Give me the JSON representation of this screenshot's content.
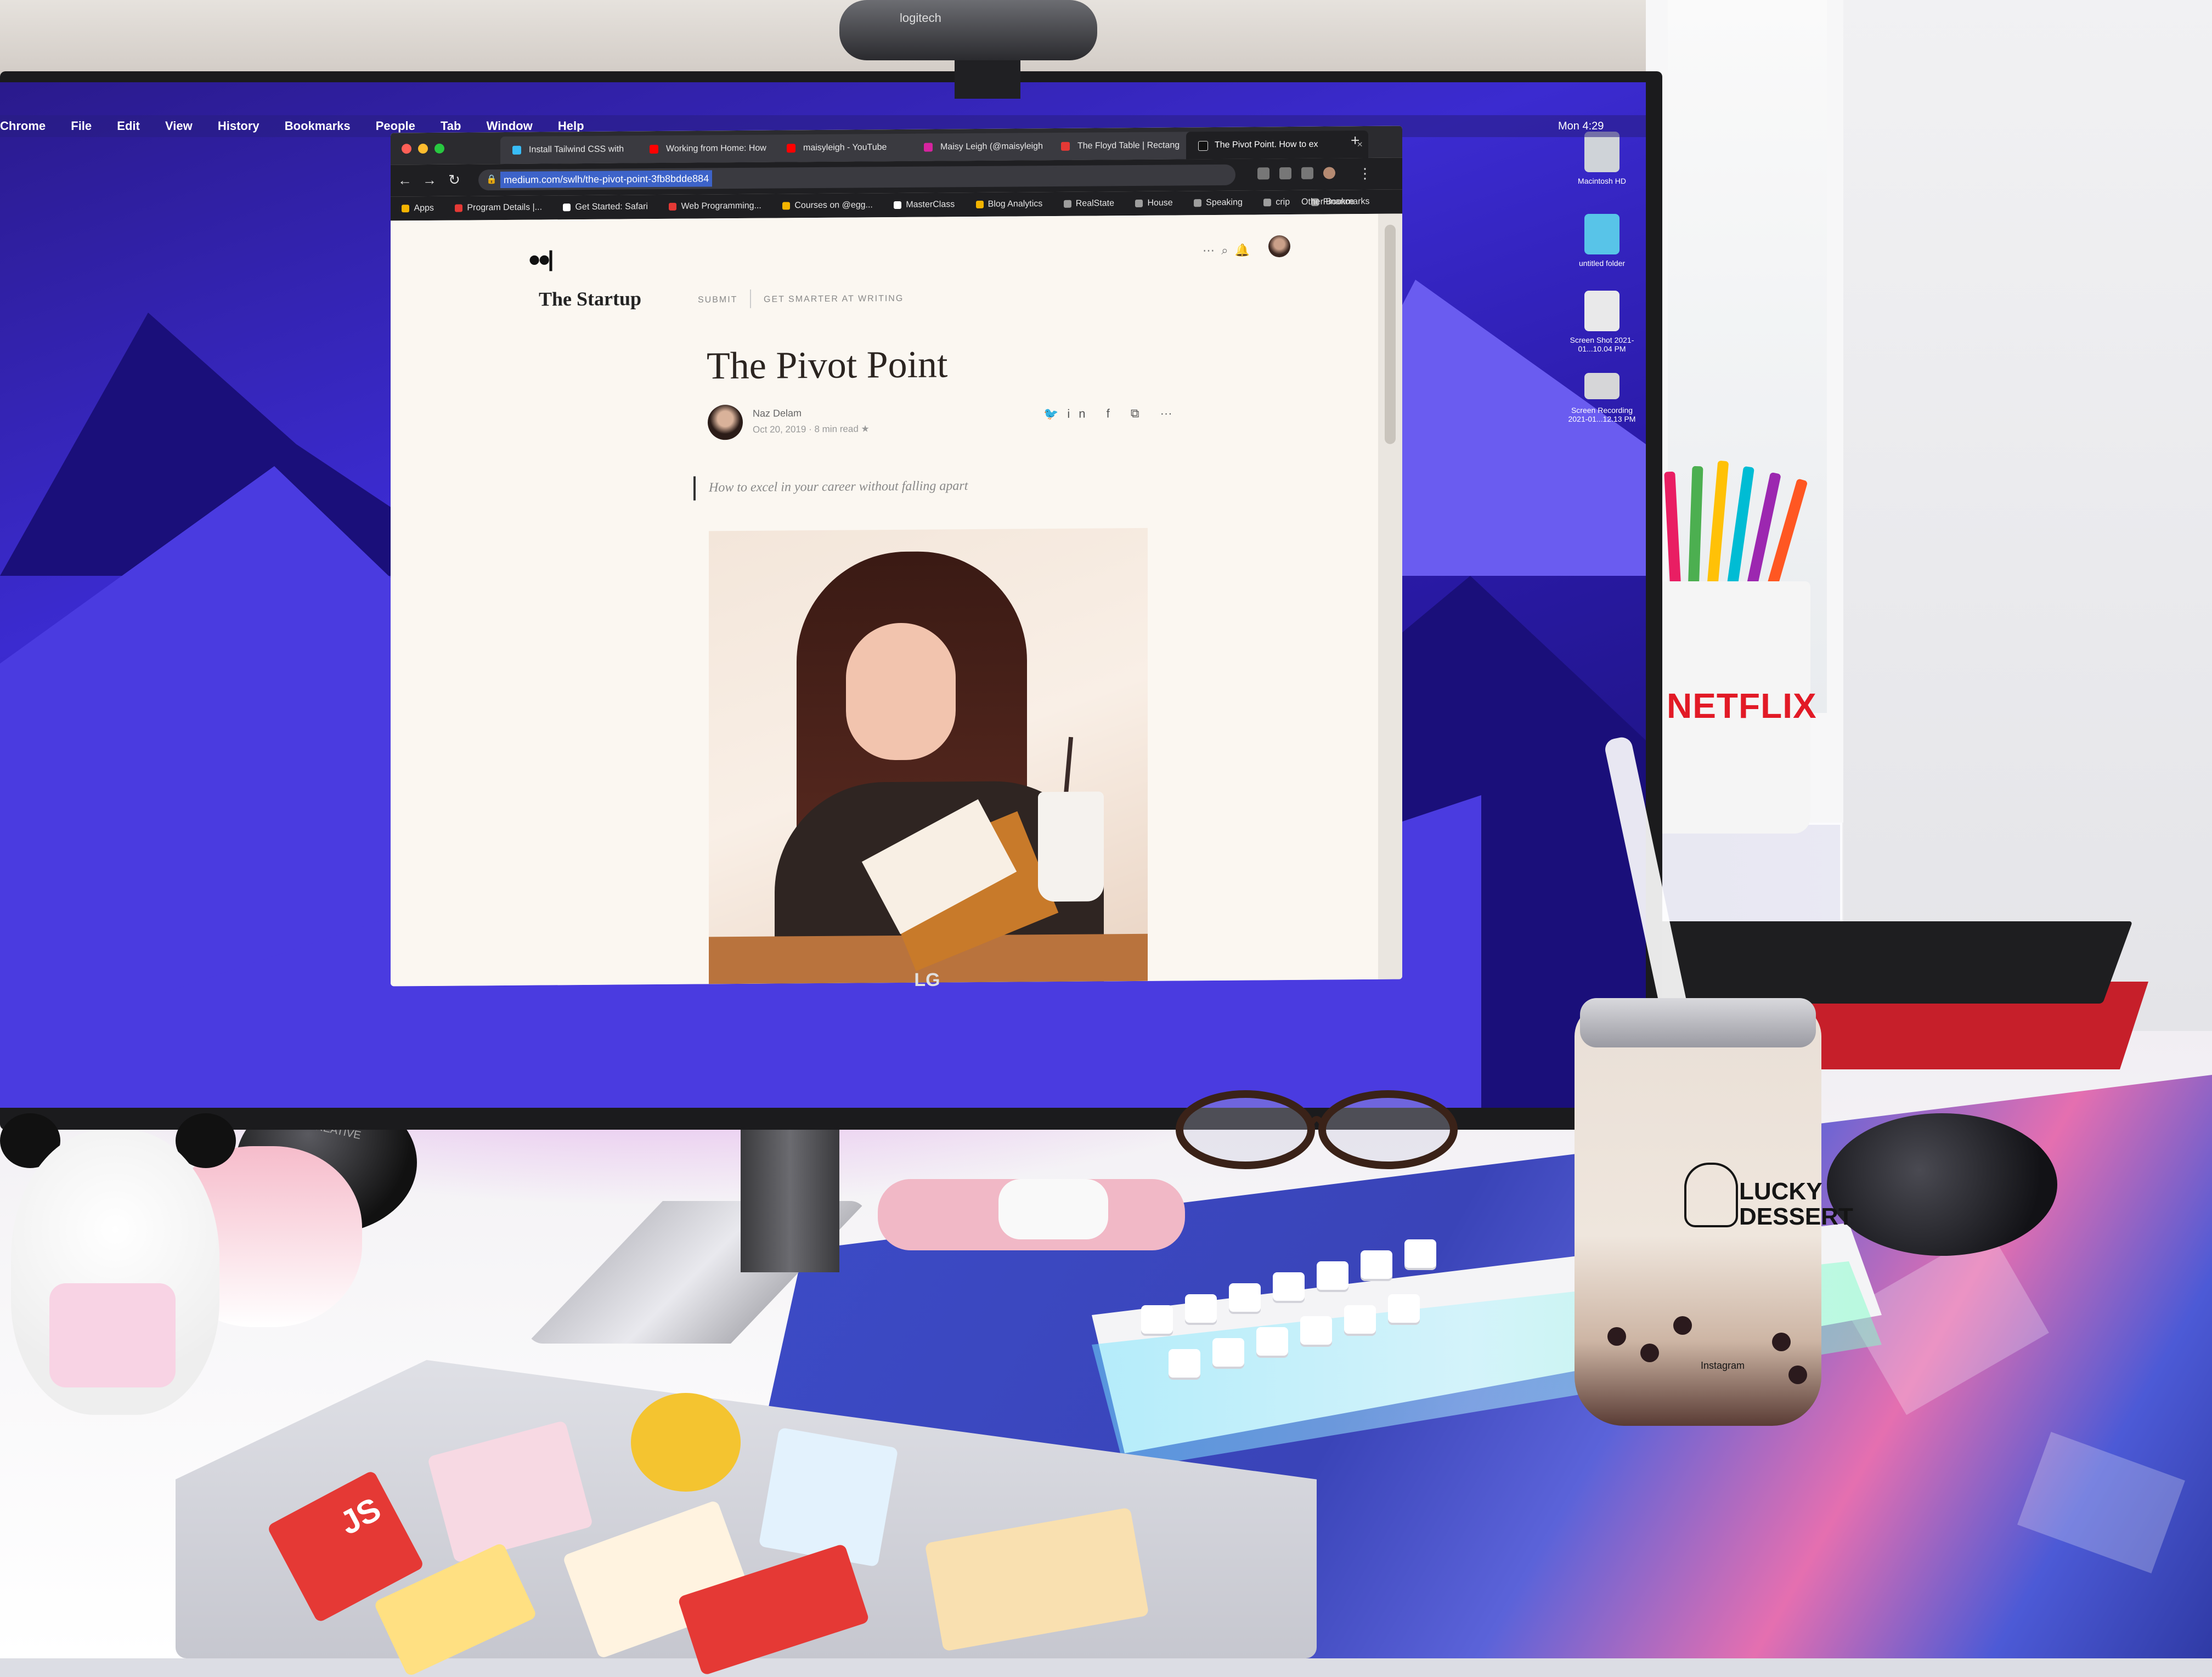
{
  "menubar": {
    "items": [
      "Chrome",
      "File",
      "Edit",
      "View",
      "History",
      "Bookmarks",
      "People",
      "Tab",
      "Window",
      "Help"
    ],
    "clock": "Mon 4:29"
  },
  "webcam": {
    "brand": "logitech"
  },
  "browser": {
    "tabs": [
      {
        "label": "Install Tailwind CSS with",
        "favicon_color": "#38bdf8"
      },
      {
        "label": "Working from Home: How",
        "favicon_color": "#ff0000"
      },
      {
        "label": "maisyleigh - YouTube",
        "favicon_color": "#ff0000"
      },
      {
        "label": "Maisy Leigh (@maisyleigh",
        "favicon_color": "#d6249f"
      },
      {
        "label": "The Floyd Table | Rectang",
        "favicon_color": "#e53935"
      },
      {
        "label": "The Pivot Point. How to ex",
        "favicon_color": "#111111",
        "active": true
      }
    ],
    "url": "medium.com/swlh/the-pivot-point-3fb8bdde884",
    "bookmarks": [
      {
        "label": "Apps",
        "color": "#f4b400"
      },
      {
        "label": "Program Details |...",
        "color": "#e53935"
      },
      {
        "label": "Get Started: Safari",
        "color": "#ffffff"
      },
      {
        "label": "Web Programming...",
        "color": "#e53935"
      },
      {
        "label": "Courses on @egg...",
        "color": "#f4b400"
      },
      {
        "label": "MasterClass",
        "color": "#ffffff"
      },
      {
        "label": "Blog Analytics",
        "color": "#f4b400"
      },
      {
        "label": "RealState",
        "color": "#9e9e9e"
      },
      {
        "label": "House",
        "color": "#9e9e9e"
      },
      {
        "label": "Speaking",
        "color": "#9e9e9e"
      },
      {
        "label": "crip",
        "color": "#9e9e9e"
      },
      {
        "label": "Finance",
        "color": "#9e9e9e"
      }
    ],
    "other_bookmarks": "Other Bookmarks"
  },
  "article": {
    "publication": "The Startup",
    "submit": "SUBMIT",
    "get_smarter": "GET SMARTER AT WRITING",
    "title": "The Pivot Point",
    "author": "Naz Delam",
    "meta": "Oct 20, 2019 · 8 min read ★",
    "subtitle": "How to excel in your career without falling apart"
  },
  "desktop_icons": [
    {
      "label": "Macintosh HD"
    },
    {
      "label": "untitled folder"
    },
    {
      "label": "Screen Shot 2021-01...10.04 PM"
    },
    {
      "label": "Screen Recording 2021-01...12.13 PM"
    }
  ],
  "monitor": {
    "brand": "LG"
  },
  "speaker": {
    "brand": "CREATIVE"
  },
  "pencil_cup": {
    "brand": "NETFLIX"
  },
  "boba": {
    "brand_line1": "LUCKY",
    "brand_line2": "DESSERT",
    "insta": "Instagram"
  },
  "laptop_sticker": {
    "js": "JS"
  }
}
